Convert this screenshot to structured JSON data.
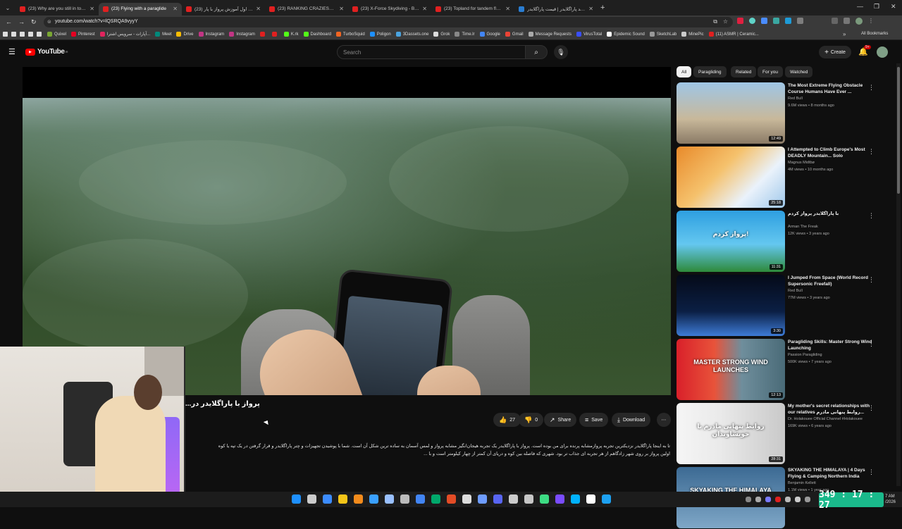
{
  "browser": {
    "tabs": [
      {
        "title": "(23) Why are you still in touch",
        "color": "#e02020"
      },
      {
        "title": "(23) Flying with a paraglide",
        "color": "#e02020",
        "active": true
      },
      {
        "title": "(23) جلسه اول آموزش پرواز با پار",
        "color": "#e02020"
      },
      {
        "title": "(23) RANKING CRAZIEST PARA",
        "color": "#e02020"
      },
      {
        "title": "(23) X-Force Skydiving - Brad P",
        "color": "#e02020"
      },
      {
        "title": "(23) Topland for tandem fly #p",
        "color": "#e02020"
      },
      {
        "title": "خرید پاراگلایدر | قیمت پاراگلایدر",
        "color": "#2a7dd1"
      }
    ],
    "new_tab": "+",
    "url": "youtube.com/watch?v=lQSRQA9vyyY",
    "bookmarks": [
      {
        "label": "Quixel",
        "color": "#7aa832"
      },
      {
        "label": "Pinterest",
        "color": "#e60023"
      },
      {
        "label": "آپارات - سرویس اشترا...",
        "color": "#e0245e"
      },
      {
        "label": "Meet",
        "color": "#00897b"
      },
      {
        "label": "Drive",
        "color": "#fbbc04"
      },
      {
        "label": "Instagram",
        "color": "#c13584"
      },
      {
        "label": "Instagram",
        "color": "#c13584"
      },
      {
        "label": "",
        "color": "#e02020"
      },
      {
        "label": "",
        "color": "#e02020"
      },
      {
        "label": "K.rk",
        "color": "#53fc18"
      },
      {
        "label": "Dashboard",
        "color": "#53fc18"
      },
      {
        "label": "TurboSquid",
        "color": "#f26522"
      },
      {
        "label": "Poligon",
        "color": "#1e90ff"
      },
      {
        "label": "3Dassets.one",
        "color": "#4aa3df"
      },
      {
        "label": "Grok",
        "color": "#dddddd"
      },
      {
        "label": "Time.lr",
        "color": "#888888"
      },
      {
        "label": "Google",
        "color": "#4285f4"
      },
      {
        "label": "Gmail",
        "color": "#ea4335"
      },
      {
        "label": "Message Requests",
        "color": "#aaaaaa"
      },
      {
        "label": "VirusTotal",
        "color": "#394eff"
      },
      {
        "label": "Epidemic Sound",
        "color": "#ffffff"
      },
      {
        "label": "SketchLab",
        "color": "#999999"
      },
      {
        "label": "MinePic",
        "color": "#cccccc"
      },
      {
        "label": "(11) ASMR | Ceramic...",
        "color": "#e02020"
      }
    ],
    "all_bookmarks": "All Bookmarks"
  },
  "youtube": {
    "logo": "YouTube",
    "country": "IR",
    "search_placeholder": "Search",
    "create_label": "Create",
    "notif_count": "9+"
  },
  "video": {
    "title": "پرواز با پاراگلایدر در...",
    "likes": "27",
    "dislikes": "0",
    "share": "Share",
    "save": "Save",
    "download": "Download",
    "description_line1": "تا به اینجا پاراگلایدر نزدیکترین تجربه پروازمشابه پرنده برای من بوده است. پرواز با پاراگلایدر یک تجربه هیجان‌انگیز مشابه پرواز و لمس آسمان به ساده ترین شکل آن است. شما با پوشیدن تجهیزات و چتر پاراگلایدر و قرار گرفتن در یک تپه یا کوه",
    "description_line2": "اولین پرواز بر روی شهر زادگاهم از هر تجربه ای جذاب تر بود. شهری که فاصله بین کوه و دریای آن کمتر از چهار کیلومتر است و با ..."
  },
  "sidebar": {
    "chips": [
      "All",
      "Paragliding",
      "Related",
      "For you",
      "Watched"
    ],
    "recommendations": [
      {
        "title": "The Most Extreme Flying Obstacle Course Humans Have Ever ...",
        "channel": "Red Bull",
        "meta": "9.6M views • 8 months ago",
        "duration": "12:49",
        "bg": "linear-gradient(180deg,#9fc6e6,#c8b89a 60%,#8a7a66)"
      },
      {
        "title": "I Attempted to Climb Europe's Most DEADLY Mountain... Solo",
        "channel": "Magnus Midtbø",
        "meta": "4M views • 10 months ago",
        "duration": "25:18",
        "bg": "linear-gradient(135deg,#e88a2a,#f5c16c 40%,#eaf2fb 70%,#9ec7ea)"
      },
      {
        "title": "با پاراگلایدر پرواز کردم",
        "channel": "Arman The Freak",
        "meta": "12K views • 3 years ago",
        "duration": "11:31",
        "bg": "linear-gradient(180deg,#2e9fe0,#64c7f0 55%,#2e8a3a)"
      },
      {
        "title": "I Jumped From Space (World Record Supersonic Freefall)",
        "channel": "Red Bull",
        "meta": "77M views • 3 years ago",
        "duration": "3:30",
        "bg": "linear-gradient(180deg,#050a18,#0b1f44 60%,#3d7bd6)"
      },
      {
        "title": "Paragliding Skills: Master Strong Wind Launching",
        "channel": "Passion Paragliding",
        "meta": "500K views • 7 years ago",
        "duration": "12:13",
        "bg": "linear-gradient(90deg,#d9202a,#e8533a 35%,#6f8e9c 60%,#4a6b78)"
      },
      {
        "title": "My mother's secret relationships with our relatives روابط پنهانی مادرم...",
        "channel": "Dr. Holakouee Official Channel #Holakouee",
        "meta": "169K views • 6 years ago",
        "duration": "28:31",
        "bg": "linear-gradient(90deg,#f5f5f5,#eaeaea 40%,#c9c9c9)"
      },
      {
        "title": "SKYAKING THE HIMALAYA | 4 Days Flying & Camping Northern India",
        "channel": "Benjamin Kellett",
        "meta": "1.1M views • 1 year ago",
        "duration": "",
        "bg": "linear-gradient(180deg,#3c6a93,#7fa7c7)"
      }
    ],
    "thumb_texts": [
      "",
      "",
      "پرواز کردم!",
      "",
      "MASTER STRONG WIND LAUNCHES",
      "روابط پنهانی مادرم با خویشاوندان",
      "SKYAKING THE HIMALAYA"
    ]
  },
  "taskbar": {
    "timer": "349 : 17 : 27",
    "clock_time": "7 AM",
    "clock_date": "/2026"
  }
}
